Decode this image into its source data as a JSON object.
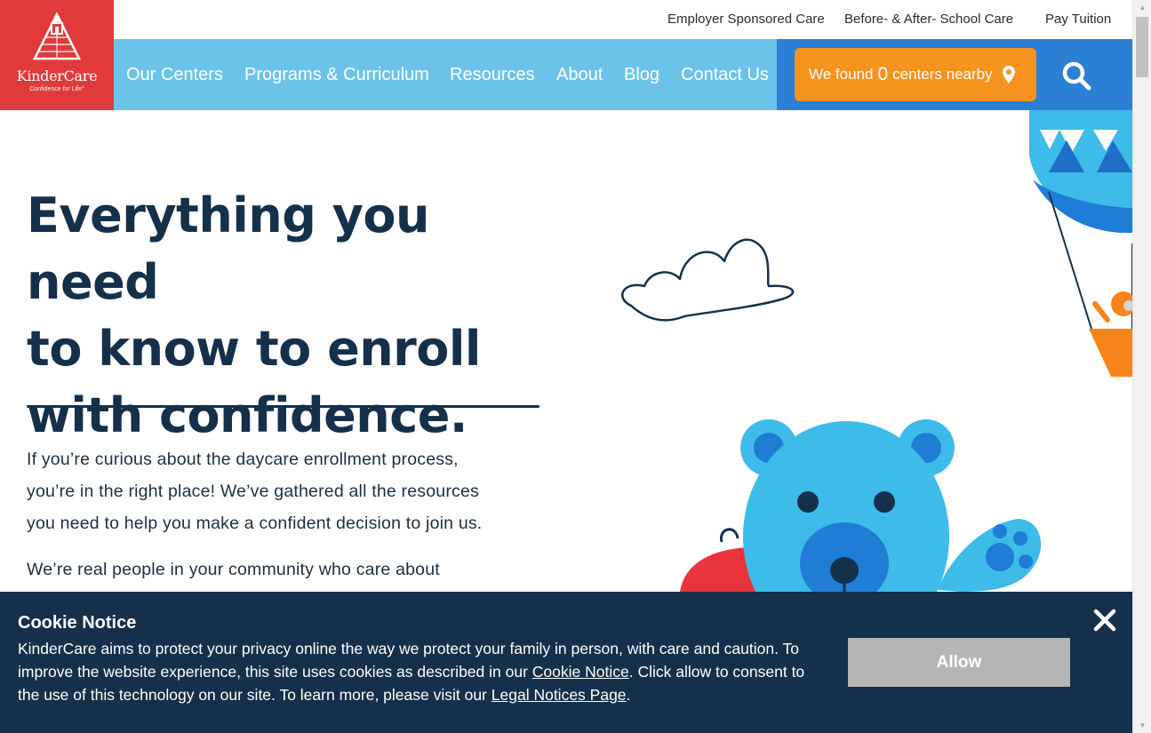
{
  "brand": {
    "name": "KinderCare",
    "tagline": "Confidence for Life°"
  },
  "utility_nav": [
    "Employer Sponsored Care",
    "Before- & After- School Care",
    "Pay Tuition"
  ],
  "main_nav": [
    "Our Centers",
    "Programs & Curriculum",
    "Resources",
    "About",
    "Blog",
    "Contact Us"
  ],
  "center_finder": {
    "prefix": "We found",
    "count": "0",
    "suffix": "centers nearby"
  },
  "hero": {
    "title_lines": [
      "Everything you need",
      "to know to enroll",
      "with confidence."
    ],
    "paragraph1_lines": [
      "If you’re curious about the daycare enrollment process,",
      "you’re in the right place! We’ve gathered all the resources",
      "you need to help you make a confident decision to join us."
    ],
    "paragraph2": "We’re real people in your community who care about"
  },
  "cookie": {
    "title": "Cookie Notice",
    "text_1": "KinderCare aims to protect your privacy online the way we protect your family in person, with care and caution. To improve the website experience, this site uses cookies as described in our ",
    "link_1": "Cookie Notice",
    "text_2": ". Click allow to consent to the use of this technology on our site. To learn more, please visit our ",
    "link_2": "Legal Notices Page",
    "text_3": ".",
    "allow_label": "Allow"
  },
  "colors": {
    "brand_red": "#e2393a",
    "nav_light_blue": "#6cc3ea",
    "nav_blue": "#2b7fd4",
    "cta_orange": "#f6921e",
    "navy": "#14304a",
    "allow_gray": "#b5b5b5"
  },
  "icons": {
    "logo": "schoolhouse-icon",
    "location": "map-pin-icon",
    "search": "search-icon",
    "close": "close-icon"
  }
}
